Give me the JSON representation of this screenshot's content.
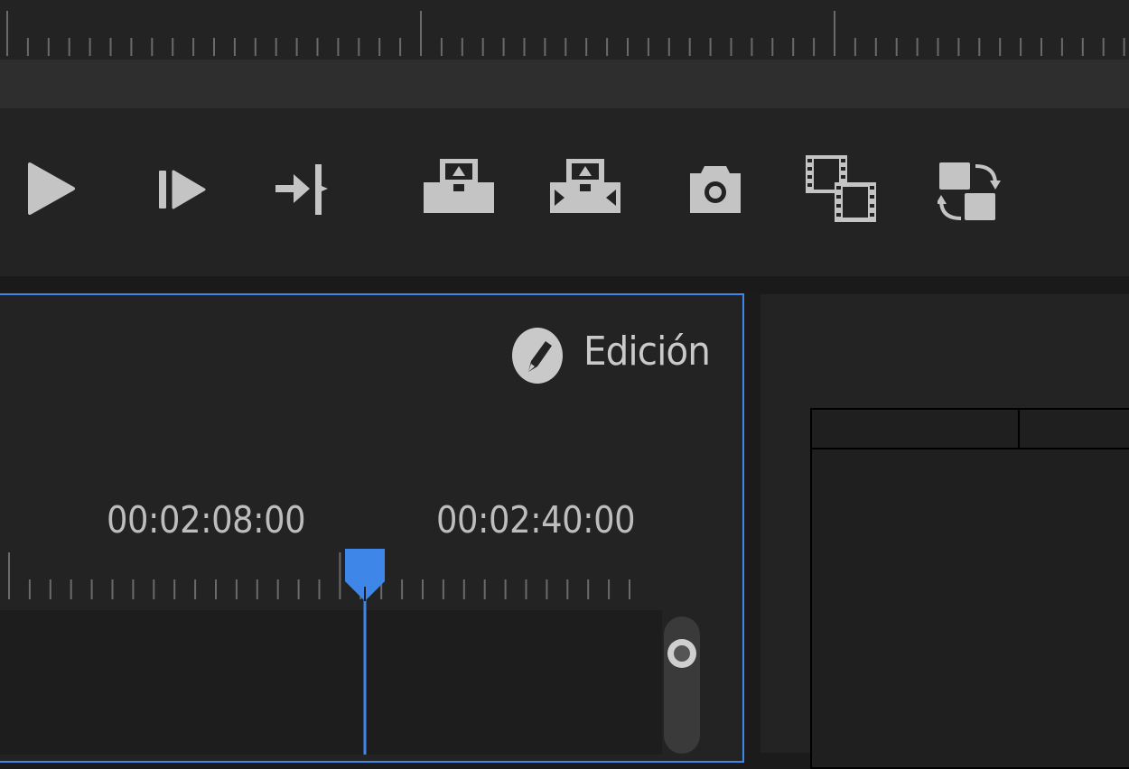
{
  "workspace": {
    "label": "Edición",
    "icon": "pencil-icon"
  },
  "timecodes": [
    "00:02:08:00",
    "00:02:40:00"
  ],
  "toolbar": {
    "buttons": [
      {
        "name": "play-button",
        "icon": "play-icon"
      },
      {
        "name": "step-forward-button",
        "icon": "step-forward-icon"
      },
      {
        "name": "go-to-out-button",
        "icon": "go-to-out-icon"
      },
      {
        "name": "lift-button",
        "icon": "lift-icon"
      },
      {
        "name": "extract-button",
        "icon": "extract-icon"
      },
      {
        "name": "export-frame-button",
        "icon": "camera-icon"
      },
      {
        "name": "multi-camera-button",
        "icon": "film-frames-icon"
      },
      {
        "name": "swap-button",
        "icon": "swap-icon"
      }
    ]
  },
  "colors": {
    "accent": "#3e86e8",
    "icon": "#c4c4c4",
    "background": "#232323"
  }
}
